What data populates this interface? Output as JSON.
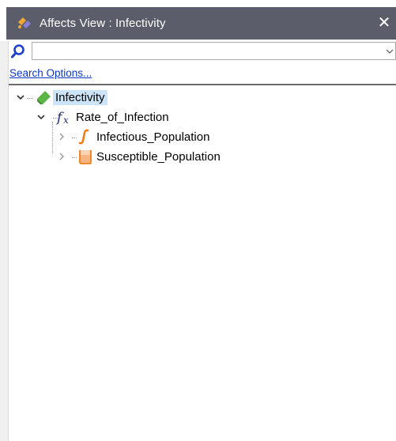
{
  "window": {
    "title": "Affects View : Infectivity",
    "close_glyph": "✕"
  },
  "search": {
    "value": "",
    "placeholder": "",
    "options_link": "Search Options..."
  },
  "tree": {
    "root": {
      "label": "Infectivity",
      "icon": "converter-icon",
      "expanded": true,
      "selected": true
    },
    "level1": {
      "label": "Rate_of_Infection",
      "icon": "fx-icon",
      "expanded": true
    },
    "level2": [
      {
        "label": "Infectious_Population",
        "icon": "integral-icon",
        "expanded": false
      },
      {
        "label": "Susceptible_Population",
        "icon": "stock-icon",
        "expanded": false
      }
    ]
  },
  "colors": {
    "titlebar": "#5b5e6a",
    "selection": "#cce4f7",
    "link": "#0b38c9",
    "converter_green": "#5bb544",
    "fx_navy": "#1f2a7a",
    "integral_orange": "#f07c14"
  }
}
